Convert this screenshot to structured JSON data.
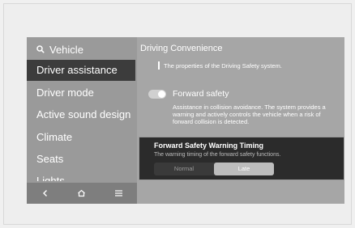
{
  "sidebar": {
    "header_label": "Vehicle",
    "items": [
      {
        "label": "Driver assistance",
        "active": true
      },
      {
        "label": "Driver mode",
        "active": false
      },
      {
        "label": "Active sound design",
        "active": false
      },
      {
        "label": "Climate",
        "active": false
      },
      {
        "label": "Seats",
        "active": false
      },
      {
        "label": "Lights",
        "active": false
      }
    ],
    "footer_icons": [
      "back-icon",
      "home-icon",
      "menu-icon"
    ]
  },
  "main": {
    "title": "Driving Convenience",
    "description": "The properties of the Driving Safety system.",
    "forward_safety": {
      "label": "Forward safety",
      "enabled": true,
      "description": "Assistance in collision avoidance. The system provides a warning and actively controls the vehicle when a risk of  forward collision is detected."
    }
  },
  "popup": {
    "title": "Forward Safety Warning Timing",
    "subtitle": "The warning timing of the forward safety functions.",
    "options": [
      {
        "label": "Normal",
        "selected": false
      },
      {
        "label": "Late",
        "selected": true
      }
    ]
  },
  "colors": {
    "screen_bg": "#a6a6a6",
    "active_item_bg": "#3c3c3c",
    "popup_bg": "#2b2b2b",
    "selected_option_bg": "#bdbdbd"
  }
}
